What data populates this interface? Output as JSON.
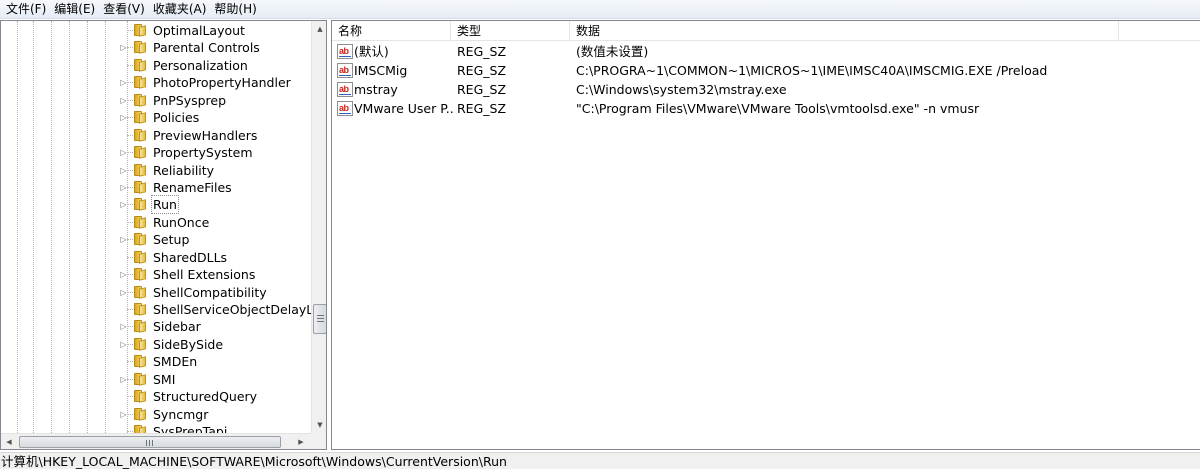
{
  "menubar": {
    "items": [
      "文件(F)",
      "编辑(E)",
      "查看(V)",
      "收藏夹(A)",
      "帮助(H)"
    ]
  },
  "tree": {
    "items": [
      {
        "label": "OptimalLayout",
        "expandable": false
      },
      {
        "label": "Parental Controls",
        "expandable": true
      },
      {
        "label": "Personalization",
        "expandable": false
      },
      {
        "label": "PhotoPropertyHandler",
        "expandable": true
      },
      {
        "label": "PnPSysprep",
        "expandable": true
      },
      {
        "label": "Policies",
        "expandable": true
      },
      {
        "label": "PreviewHandlers",
        "expandable": false
      },
      {
        "label": "PropertySystem",
        "expandable": true
      },
      {
        "label": "Reliability",
        "expandable": true
      },
      {
        "label": "RenameFiles",
        "expandable": true
      },
      {
        "label": "Run",
        "expandable": true,
        "selected": true
      },
      {
        "label": "RunOnce",
        "expandable": false
      },
      {
        "label": "Setup",
        "expandable": true
      },
      {
        "label": "SharedDLLs",
        "expandable": false
      },
      {
        "label": "Shell Extensions",
        "expandable": true
      },
      {
        "label": "ShellCompatibility",
        "expandable": true
      },
      {
        "label": "ShellServiceObjectDelayLoad",
        "expandable": false
      },
      {
        "label": "Sidebar",
        "expandable": true
      },
      {
        "label": "SideBySide",
        "expandable": true
      },
      {
        "label": "SMDEn",
        "expandable": false
      },
      {
        "label": "SMI",
        "expandable": true
      },
      {
        "label": "StructuredQuery",
        "expandable": false
      },
      {
        "label": "Syncmgr",
        "expandable": true
      },
      {
        "label": "SysPrepTapi",
        "expandable": false
      }
    ],
    "vscroll": {
      "up_arrow": "▲",
      "down_arrow": "▼"
    },
    "hscroll": {
      "left_arrow": "◀",
      "right_arrow": "▶"
    }
  },
  "list": {
    "columns": [
      "名称",
      "类型",
      "数据"
    ],
    "rows": [
      {
        "name": "(默认)",
        "type": "REG_SZ",
        "data": "(数值未设置)"
      },
      {
        "name": "IMSCMig",
        "type": "REG_SZ",
        "data": "C:\\PROGRA~1\\COMMON~1\\MICROS~1\\IME\\IMSC40A\\IMSCMIG.EXE /Preload"
      },
      {
        "name": "mstray",
        "type": "REG_SZ",
        "data": "C:\\Windows\\system32\\mstray.exe"
      },
      {
        "name": "VMware User P...",
        "type": "REG_SZ",
        "data": "\"C:\\Program Files\\VMware\\VMware Tools\\vmtoolsd.exe\" -n vmusr"
      }
    ],
    "value_icon_text": "ab"
  },
  "statusbar": {
    "path": "计算机\\HKEY_LOCAL_MACHINE\\SOFTWARE\\Microsoft\\Windows\\CurrentVersion\\Run"
  }
}
